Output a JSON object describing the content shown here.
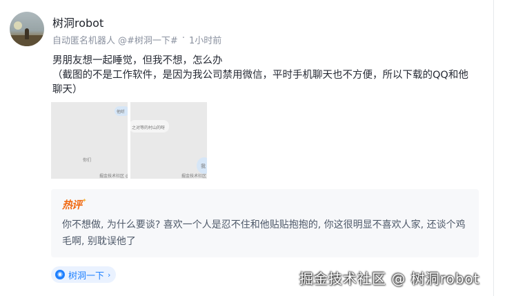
{
  "post": {
    "author": "树洞robot",
    "meta": {
      "subtitle": "自动匿名机器人",
      "handle": "@#树洞一下#",
      "dot": "·",
      "time": "1小时前"
    },
    "content_line1": "男朋友想一起睡觉，但我不想，怎么办",
    "content_line2": "（截图的不是工作软件，是因为我公司禁用微信，平时手机聊天也不方便，所以下载的QQ和他聊天）"
  },
  "images": [
    {
      "name": "chat-screenshot-1",
      "caption": "掘金技术社区 @",
      "text_right": "他听",
      "text_mid": "你们"
    },
    {
      "name": "chat-screenshot-2",
      "caption": "掘金技术社区",
      "text_left": "之对等的村山的呀",
      "text_right": "我"
    }
  ],
  "hot_comment": {
    "tag": "热评",
    "text": "你不想做, 为什么要谈? 喜欢一个人是忍不住和他贴贴抱抱的, 你这很明显不喜欢人家, 还谈个鸡毛啊, 别耽误他了"
  },
  "topic_tag": {
    "label": "树洞一下",
    "icon": "tree-hole-icon"
  },
  "watermark": "掘金技术社区 @ 树洞robot",
  "colors": {
    "accent": "#1e80ff",
    "hot": "#f06a14",
    "meta": "#8a919f"
  }
}
